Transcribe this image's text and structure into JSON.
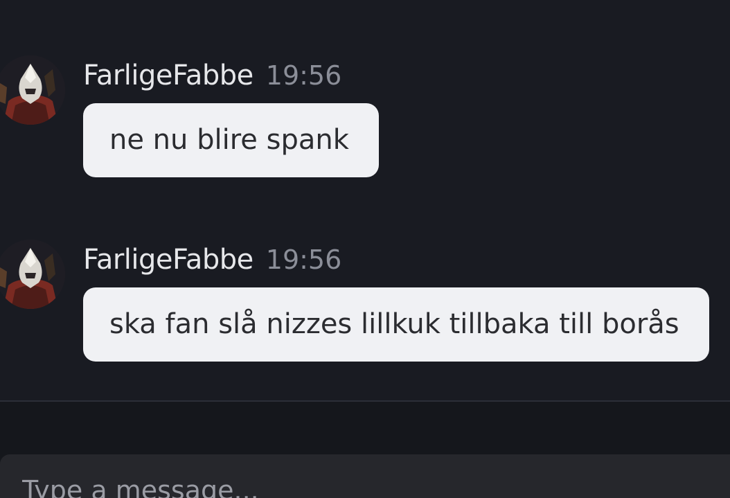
{
  "messages": [
    {
      "username": "FarligeFabbe",
      "timestamp": "19:56",
      "text": "ne nu blire spank",
      "avatar_icon": "hooded-warrior-avatar"
    },
    {
      "username": "FarligeFabbe",
      "timestamp": "19:56",
      "text": "ska fan slå nizzes lillkuk tillbaka till borås",
      "avatar_icon": "hooded-warrior-avatar"
    }
  ],
  "composer": {
    "placeholder": "Type a message..."
  },
  "colors": {
    "background": "#191b22",
    "bubble": "#f0f1f4",
    "username": "#e6e7ea",
    "timestamp": "#8b8e98",
    "composer": "#26272c"
  }
}
